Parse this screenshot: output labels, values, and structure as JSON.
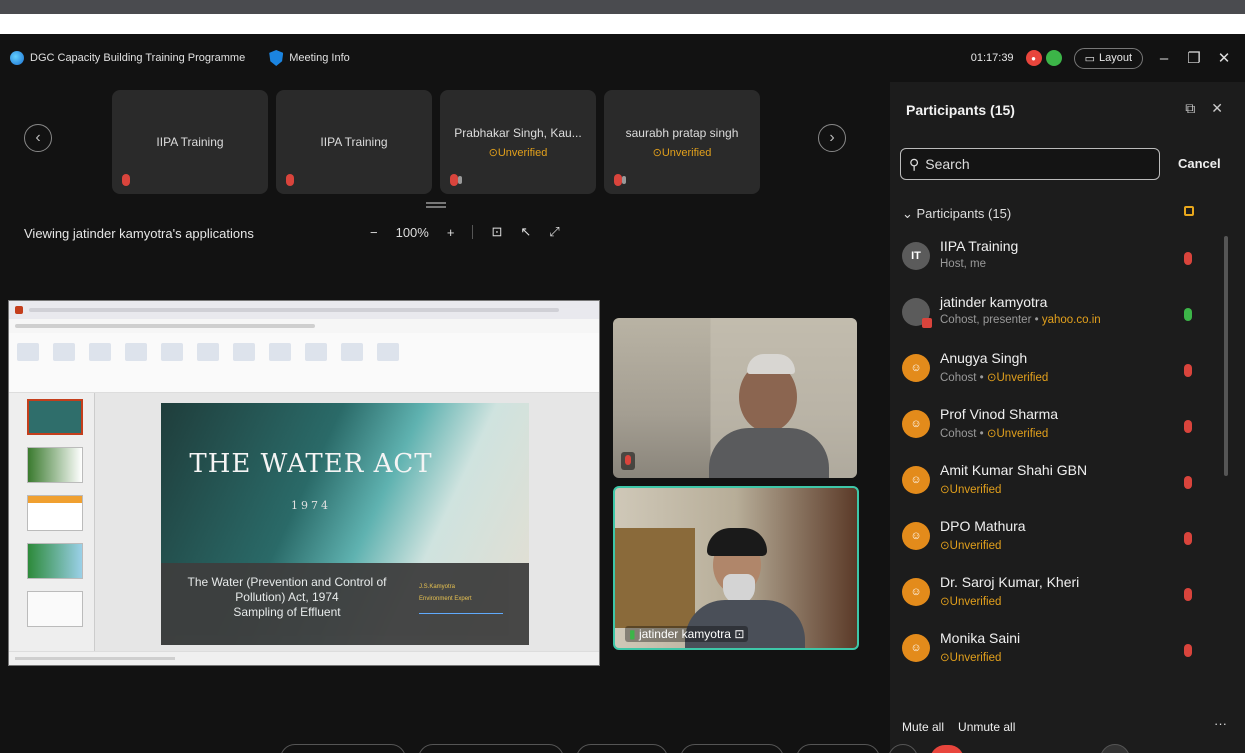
{
  "titlebar": {
    "app_title": "DGC Capacity Building Training Programme",
    "meeting_info": "Meeting Info",
    "timer": "01:17:39",
    "layout_label": "Layout",
    "minimize": "–",
    "restore": "❐",
    "close": "✕"
  },
  "thumbnails": [
    {
      "name": "IIPA Training",
      "status": ""
    },
    {
      "name": "IIPA Training",
      "status": ""
    },
    {
      "name": "Prabhakar Singh, Kau...",
      "status": "⊙Unverified"
    },
    {
      "name": "saurabh pratap singh",
      "status": "⊙Unverified"
    }
  ],
  "share": {
    "viewing_text": "Viewing jatinder kamyotra's applications",
    "zoom_minus": "−",
    "zoom_value": "100%",
    "zoom_plus": "+"
  },
  "slide": {
    "title": "THE WATER ACT",
    "year": "1974",
    "subtitle_line1": "The Water (Prevention and Control of",
    "subtitle_line2": "Pollution) Act, 1974",
    "subtitle_line3": "Sampling of Effluent",
    "author_name": "J.S.Kamyotra",
    "author_role": "Environment Expert"
  },
  "videos": {
    "tile2_name": "jatinder kamyotra"
  },
  "participants": {
    "header": "Participants (15)",
    "search_placeholder": "Search",
    "cancel_label": "Cancel",
    "section_label": "Participants (15)",
    "items": [
      {
        "initials": "IT",
        "name": "IIPA Training",
        "role": "Host, me",
        "role_extra": "",
        "mic": "muted"
      },
      {
        "initials": "",
        "name": "jatinder kamyotra",
        "role": "Cohost, presenter • ",
        "role_extra": "yahoo.co.in",
        "mic": "on"
      },
      {
        "initials": "",
        "name": "Anugya Singh",
        "role": "Cohost • ",
        "role_extra": "⊙Unverified",
        "mic": "muted"
      },
      {
        "initials": "",
        "name": "Prof Vinod Sharma",
        "role": "Cohost • ",
        "role_extra": "⊙Unverified",
        "mic": "muted"
      },
      {
        "initials": "",
        "name": "Amit Kumar Shahi GBN",
        "role": "",
        "role_extra": "⊙Unverified",
        "mic": "muted"
      },
      {
        "initials": "",
        "name": "DPO Mathura",
        "role": "",
        "role_extra": "⊙Unverified",
        "mic": "muted"
      },
      {
        "initials": "",
        "name": "Dr. Saroj Kumar, Kheri",
        "role": "",
        "role_extra": "⊙Unverified",
        "mic": "muted"
      },
      {
        "initials": "",
        "name": "Monika Saini",
        "role": "",
        "role_extra": "⊙Unverified",
        "mic": "muted"
      }
    ],
    "mute_all": "Mute all",
    "unmute_all": "Unmute all",
    "more": "···"
  }
}
